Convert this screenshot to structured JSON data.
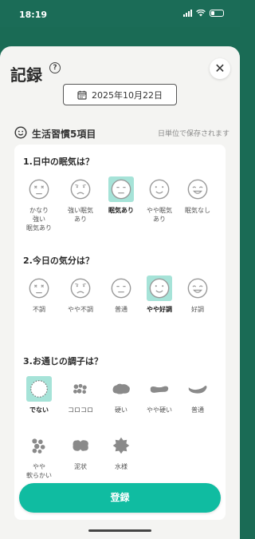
{
  "status_bar": {
    "time": "18:19"
  },
  "header": {
    "title": "記録",
    "help_label": "?",
    "close_label": "✕"
  },
  "date": {
    "value": "2025年10月22日"
  },
  "section": {
    "title": "生活習慣5項目",
    "note": "日単位で保存されます"
  },
  "questions": [
    {
      "title": "1.日中の眠気は？",
      "options": [
        {
          "label": "かなり\n強い\n眠気あり",
          "icon": "face-x-eyes",
          "selected": false
        },
        {
          "label": "強い眠気\nあり",
          "icon": "face-sad",
          "selected": false
        },
        {
          "label": "眠気あり",
          "icon": "face-neutral",
          "selected": true
        },
        {
          "label": "やや眠気\nあり",
          "icon": "face-smile",
          "selected": false
        },
        {
          "label": "眠気なし",
          "icon": "face-grin",
          "selected": false
        }
      ]
    },
    {
      "title": "2.今日の気分は？",
      "options": [
        {
          "label": "不調",
          "icon": "face-x-eyes",
          "selected": false
        },
        {
          "label": "やや不調",
          "icon": "face-sad",
          "selected": false
        },
        {
          "label": "普通",
          "icon": "face-neutral",
          "selected": false
        },
        {
          "label": "やや好調",
          "icon": "face-smile",
          "selected": true
        },
        {
          "label": "好調",
          "icon": "face-grin",
          "selected": false
        }
      ]
    },
    {
      "title": "3.お通じの調子は？",
      "options": [
        {
          "label": "でない",
          "icon": "dotted-circle",
          "selected": true
        },
        {
          "label": "コロコロ",
          "icon": "pellets",
          "selected": false
        },
        {
          "label": "硬い",
          "icon": "lumpy",
          "selected": false
        },
        {
          "label": "やや硬い",
          "icon": "cracked",
          "selected": false
        },
        {
          "label": "普通",
          "icon": "smooth",
          "selected": false
        },
        {
          "label": "やや\n軟らかい",
          "icon": "soft-blobs",
          "selected": false
        },
        {
          "label": "泥状",
          "icon": "mushy",
          "selected": false
        },
        {
          "label": "水様",
          "icon": "watery",
          "selected": false
        }
      ]
    }
  ],
  "submit": {
    "label": "登録"
  },
  "colors": {
    "primary": "#10bca1",
    "selected_tile": "#a6e3d8",
    "header_bg": "#1b6c57"
  }
}
